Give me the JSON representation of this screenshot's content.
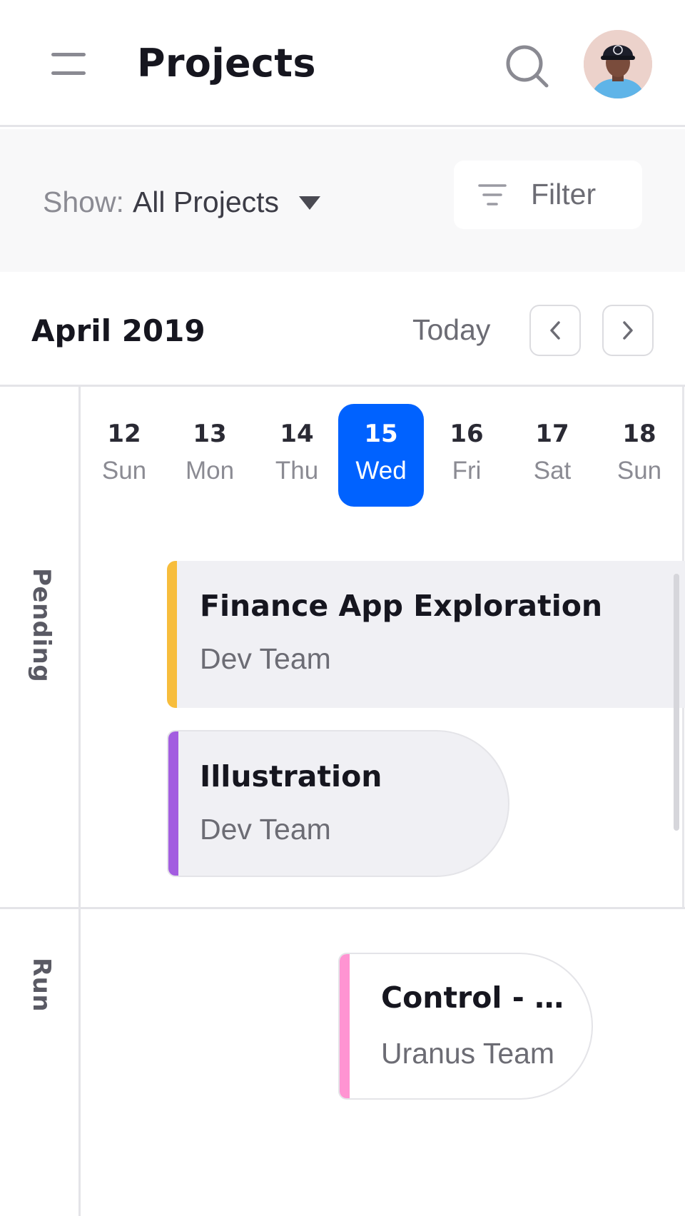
{
  "header": {
    "title": "Projects",
    "menu_icon": "hamburger-menu-icon",
    "search_icon": "search-icon",
    "avatar": "user-avatar"
  },
  "toolbar": {
    "show_label": "Show:",
    "show_value": "All Projects",
    "filter_label": "Filter",
    "filter_icon": "filter-lines-icon"
  },
  "calendar": {
    "month": "April 2019",
    "today_label": "Today",
    "prev_icon": "chevron-left-icon",
    "next_icon": "chevron-right-icon",
    "days": [
      {
        "num": "12",
        "weekday": "Sun"
      },
      {
        "num": "13",
        "weekday": "Mon"
      },
      {
        "num": "14",
        "weekday": "Thu"
      },
      {
        "num": "15",
        "weekday": "Wed",
        "active": true
      },
      {
        "num": "16",
        "weekday": "Fri"
      },
      {
        "num": "17",
        "weekday": "Sat"
      },
      {
        "num": "18",
        "weekday": "Sun"
      }
    ],
    "lanes": [
      {
        "label": "Pending"
      },
      {
        "label": "Run"
      }
    ]
  },
  "events": [
    {
      "title": "Finance App Exploration",
      "team": "Dev Team",
      "color": "#f7bd3c",
      "lane": "Pending"
    },
    {
      "title": "Illustration",
      "team": "Dev Team",
      "color": "#a35de0",
      "lane": "Pending"
    },
    {
      "title": "Control - S…",
      "team": "Uranus Team",
      "color": "#ff94d2",
      "lane": "Run"
    }
  ],
  "colors": {
    "accent": "#0062ff",
    "background": "#ffffff",
    "toolbar_bg": "#f8f8f9",
    "card_bg": "#f0f0f4"
  }
}
